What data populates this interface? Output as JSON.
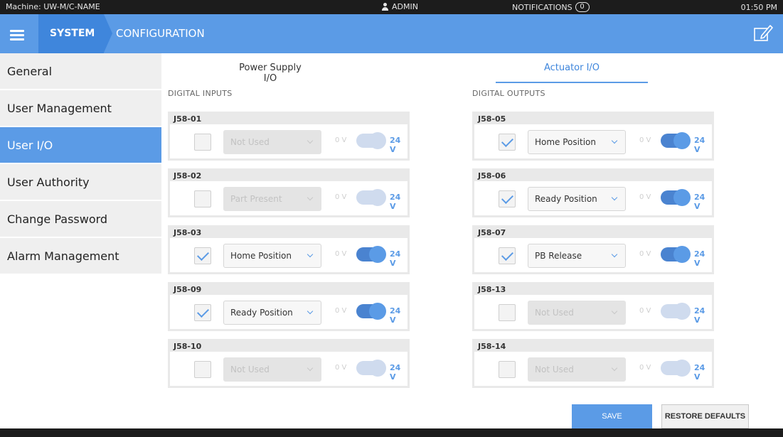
{
  "status_bar": {
    "machine": "Machine: UW-M/C-NAME",
    "user": "ADMIN",
    "notifications_label": "NOTIFICATIONS",
    "notifications_count": "0",
    "time": "01:50 PM"
  },
  "header": {
    "breadcrumb_system": "SYSTEM",
    "breadcrumb_config": "CONFIGURATION",
    "icons": {
      "menu": "hamburger-menu-icon",
      "edit": "edit-icon"
    }
  },
  "sidebar": {
    "items": [
      {
        "label": "General",
        "active": false
      },
      {
        "label": "User Management",
        "active": false
      },
      {
        "label": "User I/O",
        "active": true
      },
      {
        "label": "User Authority",
        "active": false
      },
      {
        "label": "Change Password",
        "active": false
      },
      {
        "label": "Alarm Management",
        "active": false
      }
    ]
  },
  "tabs": [
    {
      "label": "Power Supply I/O",
      "active": false
    },
    {
      "label": "Actuator I/O",
      "active": true
    }
  ],
  "inputs": {
    "heading": "DIGITAL INPUTS",
    "rows": [
      {
        "id": "J58-01",
        "checked": false,
        "value": "Not Used",
        "enabled": false,
        "label_low": "0 V",
        "label_high": "24 V"
      },
      {
        "id": "J58-02",
        "checked": false,
        "value": "Part Present",
        "enabled": false,
        "label_low": "0 V",
        "label_high": "24 V"
      },
      {
        "id": "J58-03",
        "checked": true,
        "value": "Home Position",
        "enabled": true,
        "label_low": "0 V",
        "label_high": "24 V"
      },
      {
        "id": "J58-09",
        "checked": true,
        "value": "Ready Position",
        "enabled": true,
        "label_low": "0 V",
        "label_high": "24 V"
      },
      {
        "id": "J58-10",
        "checked": false,
        "value": "Not Used",
        "enabled": false,
        "label_low": "0 V",
        "label_high": "24 V"
      }
    ]
  },
  "outputs": {
    "heading": "DIGITAL OUTPUTS",
    "rows": [
      {
        "id": "J58-05",
        "checked": true,
        "value": "Home Position",
        "enabled": true,
        "label_low": "0 V",
        "label_high": "24 V"
      },
      {
        "id": "J58-06",
        "checked": true,
        "value": "Ready Position",
        "enabled": true,
        "label_low": "0 V",
        "label_high": "24 V"
      },
      {
        "id": "J58-07",
        "checked": true,
        "value": "PB Release",
        "enabled": true,
        "label_low": "0 V",
        "label_high": "24 V"
      },
      {
        "id": "J58-13",
        "checked": false,
        "value": "Not Used",
        "enabled": false,
        "label_low": "0 V",
        "label_high": "24 V"
      },
      {
        "id": "J58-14",
        "checked": false,
        "value": "Not Used",
        "enabled": false,
        "label_low": "0 V",
        "label_high": "24 V"
      }
    ]
  },
  "buttons": {
    "save": "SAVE",
    "restore": "RESTORE DEFAULTS"
  },
  "colors": {
    "accent": "#5b9be6",
    "accent_dark": "#3f86dc",
    "bar": "#1c1c1c"
  }
}
